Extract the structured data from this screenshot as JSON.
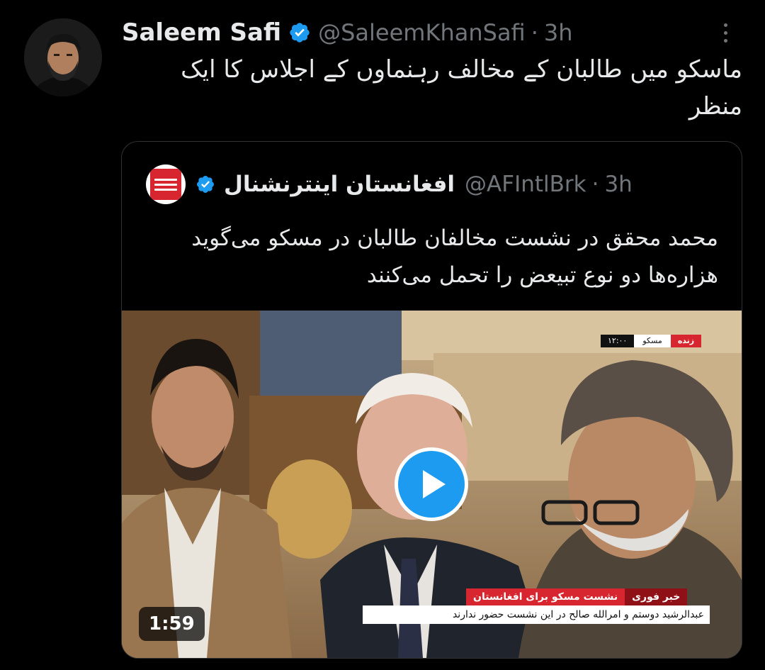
{
  "tweet": {
    "author_name": "Saleem Safi",
    "handle": "@SaleemKhanSafi",
    "separator": "·",
    "time": "3h",
    "text": "ماسکو میں طالبان کے مخالف رہنماوں کے اجلاس کا ایک منظر",
    "more_icon": "more-vertical-icon",
    "verified_icon": "verified-badge-icon"
  },
  "quote": {
    "author_name": "افغانستان اینترنشنال",
    "handle": "@AFIntlBrk",
    "separator": "·",
    "time": "3h",
    "text": "محمد محقق در نشست مخالفان طالبان در مسکو می‌گوید هزاره‌ها دو نوع تبیعض را تحمل می‌کنند",
    "avatar_icon": "afghanistan-international-logo"
  },
  "video": {
    "duration": "1:59",
    "play_icon": "play-icon",
    "live_tag": "زنده",
    "live_city": "مسکو",
    "live_time": "۱۲:۰۰",
    "breaking_label": "خبر فوری",
    "breaking_headline": "نشست مسکو برای افغانستان",
    "breaking_sub": "عبدالرشید دوستم و امرالله صالح در این نشست حضور ندارند"
  },
  "colors": {
    "background": "#000000",
    "text": "#e7e9ea",
    "muted": "#71767b",
    "verified": "#1d9bf0",
    "border": "#2f3336",
    "news_red": "#d7262f"
  }
}
